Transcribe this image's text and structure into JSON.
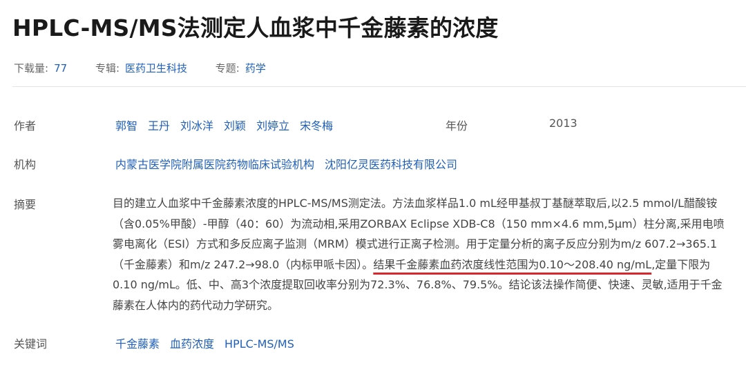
{
  "title": "HPLC-MS/MS法测定人血浆中千金藤素的浓度",
  "meta": {
    "downloads_label": "下载量:",
    "downloads_value": "77",
    "series_label": "专辑:",
    "series_value": "医药卫生科技",
    "topic_label": "专题:",
    "topic_value": "药学"
  },
  "authors": {
    "label": "作者",
    "items": [
      "郭智",
      "王丹",
      "刘冰洋",
      "刘颖",
      "刘婷立",
      "宋冬梅"
    ]
  },
  "year": {
    "label": "年份",
    "value": "2013"
  },
  "institutions": {
    "label": "机构",
    "items": [
      "内蒙古医学院附属医院药物临床试验机构",
      "沈阳亿灵医药科技有限公司"
    ]
  },
  "abstract": {
    "label": "摘要",
    "text_before": "目的建立人血浆中千金藤素浓度的HPLC-MS/MS测定法。方法血浆样品1.0 mL经甲基叔丁基醚萃取后,以2.5 mmol/L醋酸铵（含0.05%甲酸）-甲醇（40：60）为流动相,采用ZORBAX Eclipse XDB-C8（150 mm×4.6 mm,5μm）柱分离,采用电喷雾电离化（ESI）方式和多反应离子监测（MRM）模式进行正离子检测。用于定量分析的离子反应分别为m/z 607.2→365.1（千金藤素）和m/z 247.2→98.0（内标甲哌卡因）。",
    "text_highlight": "结果千金藤素血药浓度线性范围为0.10～208.40 ng/mL",
    "text_after": ",定量下限为0.10 ng/mL。低、中、高3个浓度提取回收率分别为72.3%、76.8%、79.5%。结论该法操作简便、快速、灵敏,适用于千金藤素在人体内的药代动力学研究。",
    "highlight_color": "#d9262c"
  },
  "keywords": {
    "label": "关键词",
    "items": [
      "千金藤素",
      "血药浓度",
      "HPLC-MS/MS"
    ]
  },
  "colors": {
    "link": "#1f5fb8",
    "title": "#1a1a1a",
    "label": "#555555"
  }
}
